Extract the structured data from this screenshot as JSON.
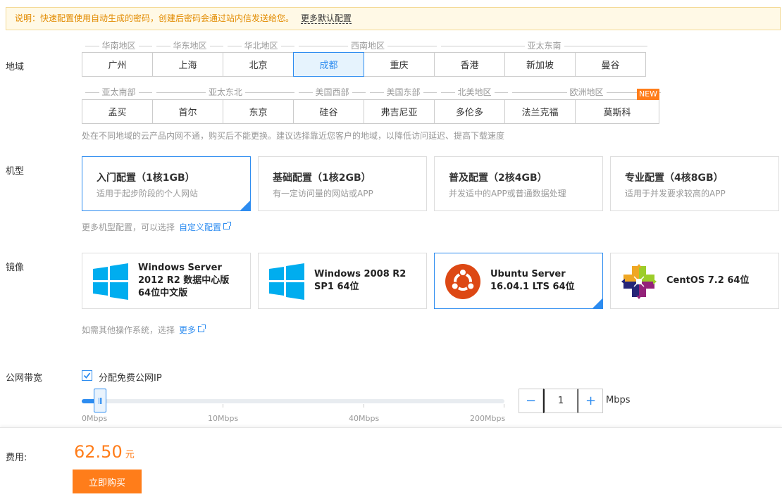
{
  "notice": {
    "text": "说明：快速配置使用自动生成的密码，创建后密码会通过站内信发送给您。",
    "more_link": "更多默认配置"
  },
  "region": {
    "label": "地域",
    "row1_groups": [
      "华南地区",
      "华东地区",
      "华北地区",
      "西南地区",
      "亚太东南"
    ],
    "row1_cities": [
      "广州",
      "上海",
      "北京",
      "成都",
      "重庆",
      "香港",
      "新加坡",
      "曼谷"
    ],
    "row2_groups": [
      "亚太南部",
      "亚太东北",
      "美国西部",
      "美国东部",
      "北美地区",
      "欧洲地区"
    ],
    "row2_cities": [
      "孟买",
      "首尔",
      "东京",
      "硅谷",
      "弗吉尼亚",
      "多伦多",
      "法兰克福",
      "莫斯科"
    ],
    "new_badge": "NEW",
    "selected": "成都",
    "hint": "处在不同地域的云产品内网不通，购买后不能更换。建议选择靠近您客户的地域，以降低访问延迟、提高下载速度"
  },
  "model": {
    "label": "机型",
    "options": [
      {
        "title": "入门配置（1核1GB）",
        "desc": "适用于起步阶段的个人网站"
      },
      {
        "title": "基础配置（1核2GB）",
        "desc": "有一定访问量的网站或APP"
      },
      {
        "title": "普及配置（2核4GB）",
        "desc": "并发适中的APP或普通数据处理"
      },
      {
        "title": "专业配置（4核8GB）",
        "desc": "适用于并发要求较高的APP"
      }
    ],
    "selected_index": 0,
    "hint": "更多机型配置，可以选择",
    "hint_link": "自定义配置"
  },
  "image": {
    "label": "镜像",
    "options": [
      {
        "name": "Windows Server 2012 R2 数据中心版 64位中文版",
        "icon": "windows-icon"
      },
      {
        "name": "Windows 2008 R2 SP1 64位",
        "icon": "windows-icon"
      },
      {
        "name": "Ubuntu Server 16.04.1 LTS 64位",
        "icon": "ubuntu-icon"
      },
      {
        "name": "CentOS 7.2 64位",
        "icon": "centos-icon"
      }
    ],
    "selected_index": 2,
    "hint": "如需其他操作系统，选择",
    "hint_link": "更多"
  },
  "bandwidth": {
    "label": "公网带宽",
    "checkbox_label": "分配免费公网IP",
    "checked": true,
    "tick_labels": [
      "0Mbps",
      "10Mbps",
      "40Mbps",
      "200Mbps"
    ],
    "value": "1",
    "unit": "Mbps",
    "minus": "−",
    "plus": "+"
  },
  "footer": {
    "fee_label": "费用:",
    "price": "62.50",
    "currency": "元",
    "buy_label": "立即购买"
  },
  "colors": {
    "accent": "#2d8cf0",
    "price": "#ff7d1a",
    "windows": "#00adef",
    "ubuntu": "#dd4814"
  }
}
